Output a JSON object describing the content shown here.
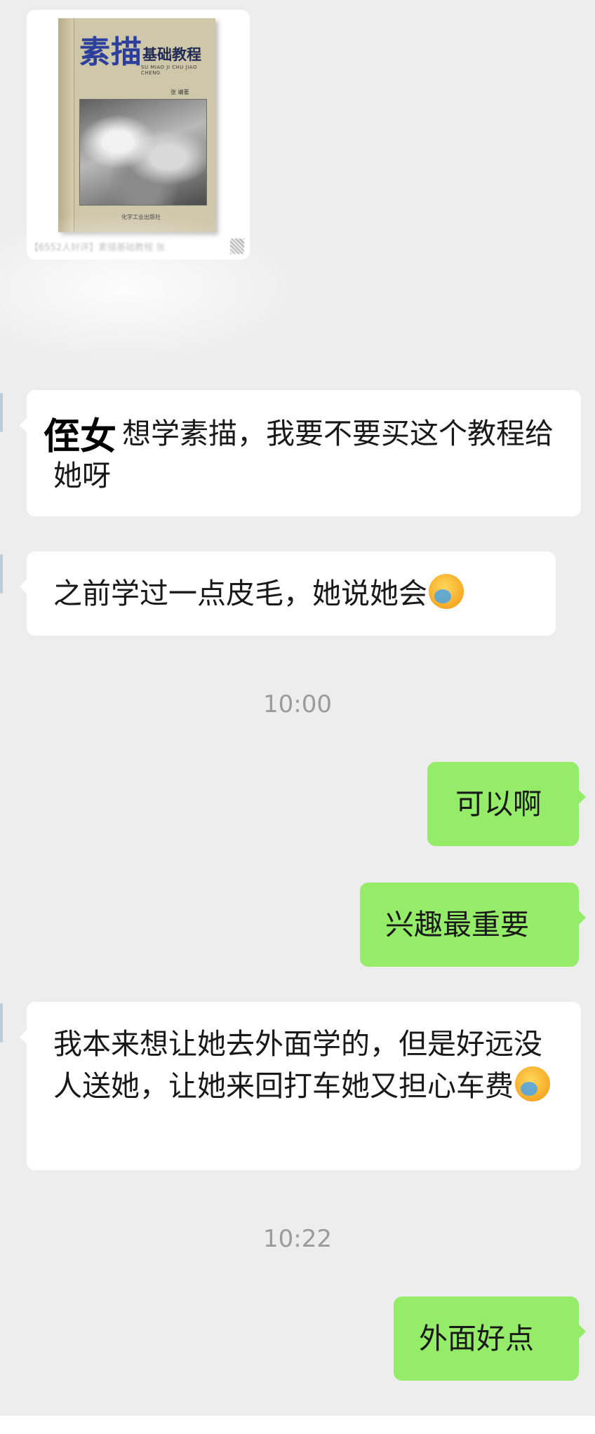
{
  "book_card": {
    "cover_title": "素描",
    "cover_subtitle": "基础教程",
    "cover_pinyin": "SU MIAO JI CHU JIAO CHENG",
    "cover_author": "张 编著",
    "cover_publisher": "化学工业出版社",
    "caption": "【6552人好评】素描基础教程 张"
  },
  "overlay_label": "侄女",
  "messages": [
    {
      "side": "recv",
      "text": "想学素描，我要不要买这个教程给她呀"
    },
    {
      "side": "recv",
      "text": "之前学过一点皮毛，她说她会",
      "emoji": "crying-face"
    },
    {
      "side": "time",
      "text": "10:00"
    },
    {
      "side": "sent",
      "text": "可以啊"
    },
    {
      "side": "sent",
      "text": "兴趣最重要"
    },
    {
      "side": "recv",
      "text": "我本来想让她去外面学的，但是好远没人送她，让她来回打车她又担心车费",
      "emoji": "crying-face"
    },
    {
      "side": "time",
      "text": "10:22"
    },
    {
      "side": "sent",
      "text": "外面好点"
    }
  ],
  "colors": {
    "background": "#ededed",
    "received_bubble": "#ffffff",
    "sent_bubble": "#95ec69",
    "timestamp": "#9b9b9b"
  }
}
